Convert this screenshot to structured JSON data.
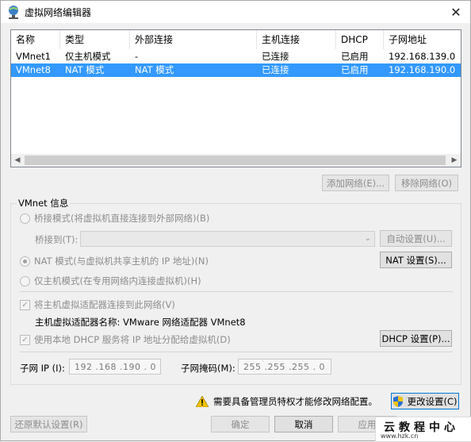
{
  "window": {
    "title": "虚拟网络编辑器",
    "close_glyph": "✕"
  },
  "list": {
    "columns": [
      "名称",
      "类型",
      "外部连接",
      "主机连接",
      "DHCP",
      "子网地址"
    ],
    "rows": [
      [
        "VMnet1",
        "仅主机模式",
        "-",
        "已连接",
        "已启用",
        "192.168.139.0"
      ],
      [
        "VMnet8",
        "NAT 模式",
        "NAT 模式",
        "已连接",
        "已启用",
        "192.168.190.0"
      ]
    ],
    "selected_row": 1
  },
  "buttons": {
    "add_network": "添加网络(E)...",
    "remove_network": "移除网络(O)",
    "auto_settings": "自动设置(U)...",
    "nat_settings": "NAT 设置(S)...",
    "dhcp_settings": "DHCP 设置(P)...",
    "change_settings": "更改设置(C)",
    "restore_defaults": "还原默认设置(R)",
    "ok": "确定",
    "cancel": "取消",
    "apply": "应用"
  },
  "vmnet_info": {
    "group_label": "VMnet 信息",
    "bridge_mode": "桥接模式(将虚拟机直接连接到外部网络)(B)",
    "bridged_to_label": "桥接到(T):",
    "nat_mode": "NAT 模式(与虚拟机共享主机的 IP 地址)(N)",
    "host_only_mode": "仅主机模式(在专用网络内连接虚拟机)(H)",
    "connect_adapter": "将主机虚拟适配器连接到此网络(V)",
    "adapter_name": "主机虚拟适配器名称: VMware 网络适配器 VMnet8",
    "use_dhcp": "使用本地 DHCP 服务将 IP 地址分配给虚拟机(D)",
    "subnet_ip_label": "子网 IP (I):",
    "subnet_ip_value": "192 .168 .190 .  0",
    "subnet_mask_label": "子网掩码(M):",
    "subnet_mask_value": "255 .255 .255 .  0",
    "selected_mode": "nat",
    "connect_adapter_checked": true,
    "use_dhcp_checked": true
  },
  "admin_notice": "需要具备管理员特权才能修改网络配置。",
  "watermark": {
    "main": "云教程中心",
    "sub": "www.hzk.cn"
  },
  "colors": {
    "selection": "#3399ff",
    "focus_border": "#0078d7"
  }
}
